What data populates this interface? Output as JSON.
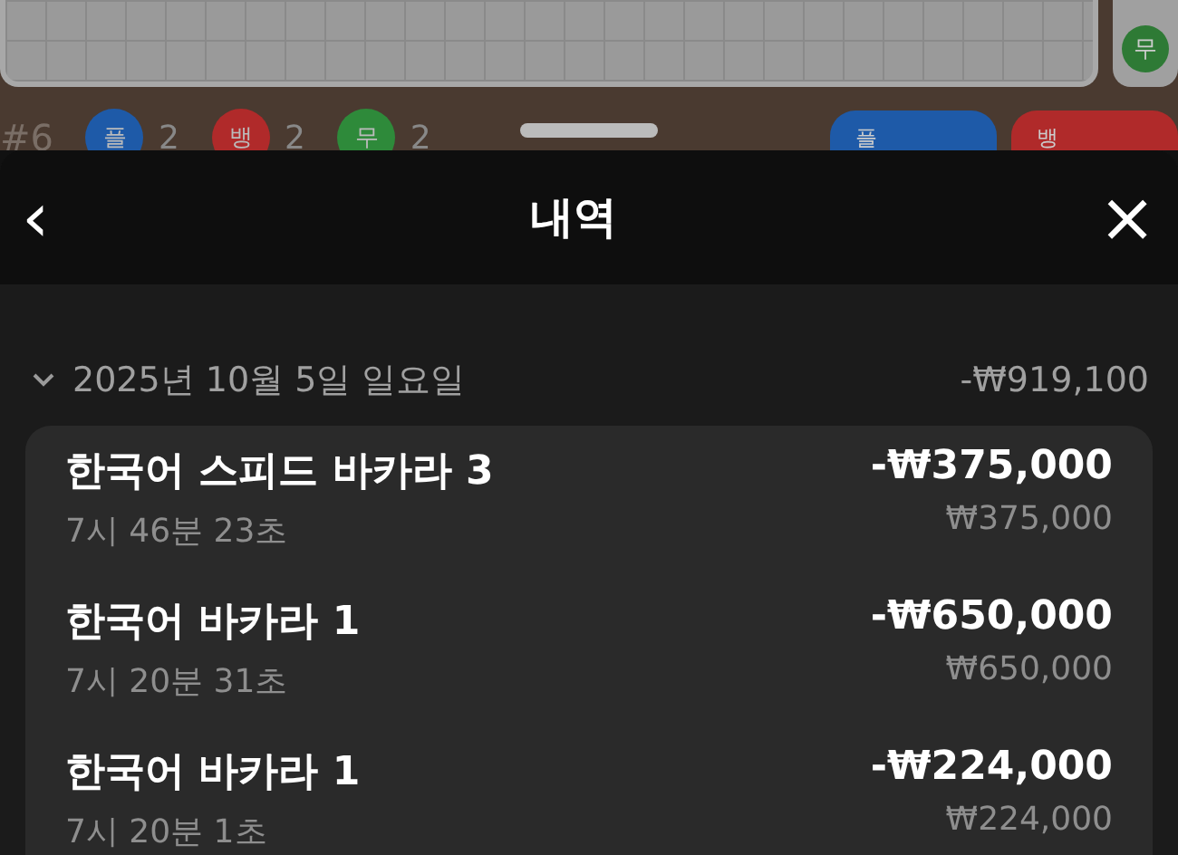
{
  "background": {
    "round_label": "#6",
    "tallies": [
      {
        "label": "플",
        "count": "2",
        "color": "#1e5aa8"
      },
      {
        "label": "뱅",
        "count": "2",
        "color": "#b02a2a"
      },
      {
        "label": "무",
        "count": "2",
        "color": "#2e8a3a"
      }
    ],
    "tie_badge": "무",
    "bets": [
      {
        "label": "플",
        "color": "#1e5aa8"
      },
      {
        "label": "뱅",
        "color": "#b02a2a"
      }
    ]
  },
  "sheet": {
    "title": "내역",
    "back_icon": "‹",
    "close_icon": "×",
    "groups": [
      {
        "date": "2025년 10월 5일 일요일",
        "total": "-₩919,100",
        "expanded": true,
        "items": [
          {
            "game": "한국어 스피드 바카라 3",
            "time": "7시 46분 23초",
            "result": "-₩375,000",
            "stake": "₩375,000"
          },
          {
            "game": "한국어 바카라 1",
            "time": "7시 20분 31초",
            "result": "-₩650,000",
            "stake": "₩650,000"
          },
          {
            "game": "한국어 바카라 1",
            "time": "7시 20분 1초",
            "result": "-₩224,000",
            "stake": "₩224,000"
          }
        ]
      }
    ]
  }
}
